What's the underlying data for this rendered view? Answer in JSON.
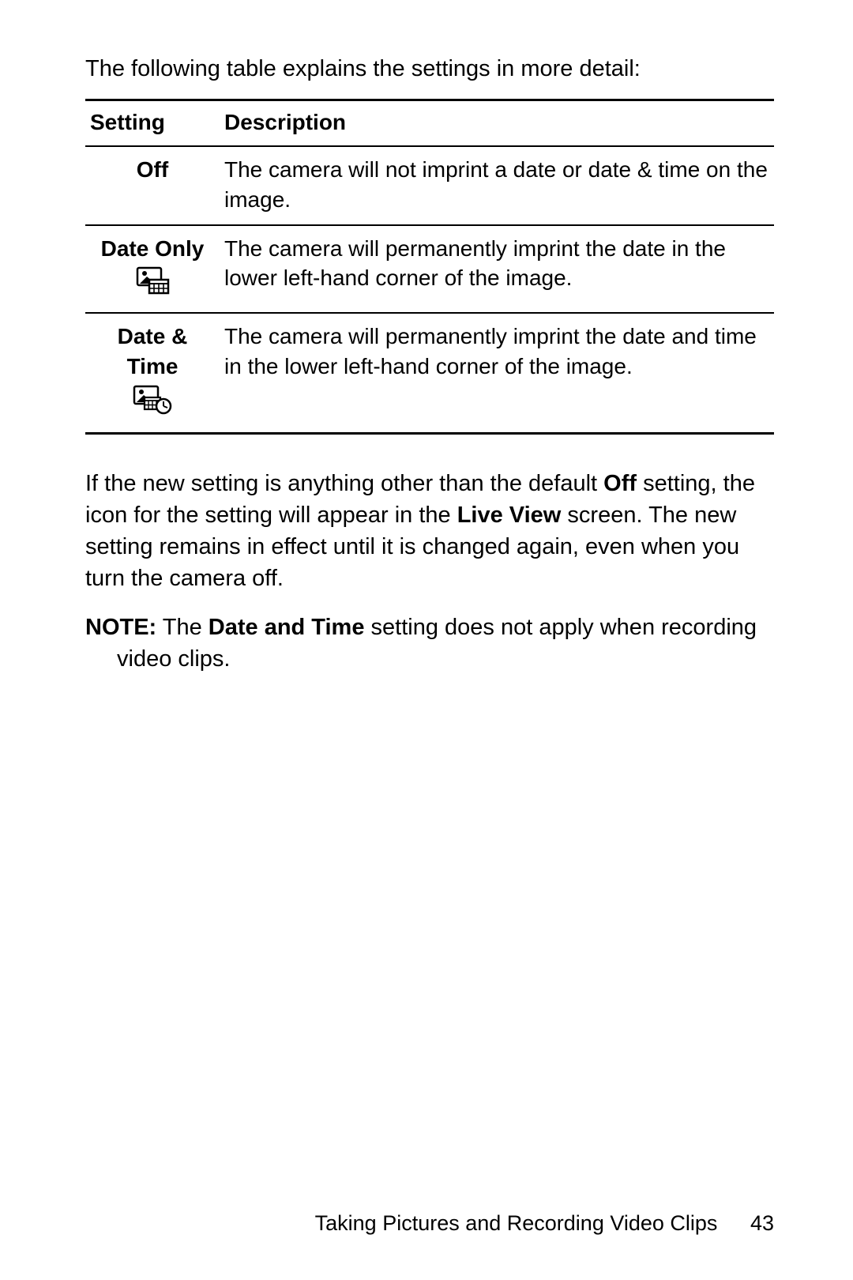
{
  "intro": "The following table explains the settings in more detail:",
  "table": {
    "headers": {
      "setting": "Setting",
      "description": "Description"
    },
    "rows": [
      {
        "setting": "Off",
        "icon": null,
        "description": "The camera will not imprint a date or date & time on the image."
      },
      {
        "setting": "Date Only",
        "icon": "date-only",
        "description": "The camera will permanently imprint the date in the lower left-hand corner of the image."
      },
      {
        "setting": "Date & Time",
        "icon": "date-time",
        "description": "The camera will permanently imprint the date and time in the lower left-hand corner of the image."
      }
    ]
  },
  "after": {
    "p1a": "If the new setting is anything other than the default ",
    "p1b": "Off",
    "p1c": " setting, the icon for the setting will appear in the ",
    "p1d": "Live View",
    "p1e": " screen. The new setting remains in effect until it is changed again, even when you turn the camera off."
  },
  "note": {
    "label": "NOTE:",
    "a": "  The ",
    "b": "Date and Time",
    "c": " setting does not apply when recording video clips."
  },
  "footer": {
    "chapter": "Taking Pictures and Recording Video Clips",
    "page": "43"
  }
}
